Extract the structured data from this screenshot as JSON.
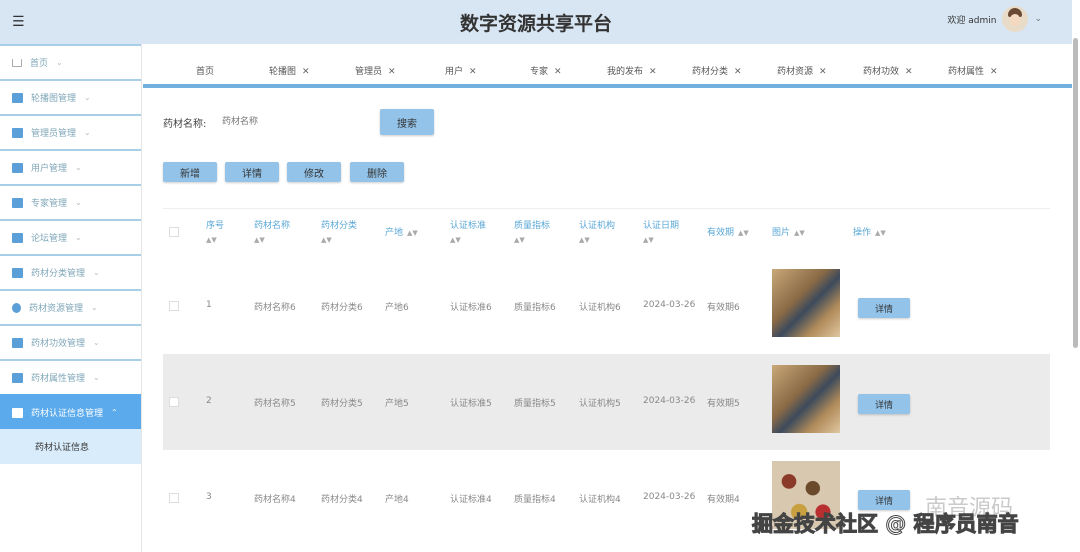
{
  "header": {
    "title": "数字资源共享平台",
    "welcome": "欢迎 admin"
  },
  "sidebar": {
    "items": [
      {
        "label": "首页",
        "icon": "home-icon"
      },
      {
        "label": "轮播图管理",
        "icon": "monitor-icon"
      },
      {
        "label": "管理员管理",
        "icon": "briefcase-icon"
      },
      {
        "label": "用户管理",
        "icon": "user-icon"
      },
      {
        "label": "专家管理",
        "icon": "user-icon"
      },
      {
        "label": "论坛管理",
        "icon": "forum-icon"
      },
      {
        "label": "药材分类管理",
        "icon": "book-icon"
      },
      {
        "label": "药材资源管理",
        "icon": "drop-icon"
      },
      {
        "label": "药材功效管理",
        "icon": "archive-icon"
      },
      {
        "label": "药材属性管理",
        "icon": "card-icon"
      },
      {
        "label": "药材认证信息管理",
        "icon": "laptop-icon"
      }
    ],
    "sub_items": [
      {
        "label": "药材认证信息"
      }
    ]
  },
  "tabs": [
    "首页",
    "轮播图",
    "管理员",
    "用户",
    "专家",
    "我的发布",
    "药材分类",
    "药材资源",
    "药材功效",
    "药材属性"
  ],
  "search": {
    "label": "药材名称:",
    "placeholder": "药材名称",
    "button": "搜索"
  },
  "actions": {
    "add": "新增",
    "detail": "详情",
    "edit": "修改",
    "delete": "删除"
  },
  "table": {
    "columns": [
      "序号",
      "药材名称",
      "药材分类",
      "产地",
      "认证标准",
      "质量指标",
      "认证机构",
      "认证日期",
      "有效期",
      "图片",
      "操作"
    ],
    "rows": [
      {
        "c": [
          "1",
          "药材名称6",
          "药材分类6",
          "产地6",
          "认证标准6",
          "质量指标6",
          "认证机构6",
          "2024-03-26",
          "有效期6"
        ],
        "btn": "详情"
      },
      {
        "c": [
          "2",
          "药材名称5",
          "药材分类5",
          "产地5",
          "认证标准5",
          "质量指标5",
          "认证机构5",
          "2024-03-26",
          "有效期5"
        ],
        "btn": "详情"
      },
      {
        "c": [
          "3",
          "药材名称4",
          "药材分类4",
          "产地4",
          "认证标准4",
          "质量指标4",
          "认证机构4",
          "2024-03-26",
          "有效期4"
        ],
        "btn": "详情"
      }
    ]
  },
  "watermark": {
    "text": "掘金技术社区 @ 程序员南音",
    "faint": "南音源码"
  },
  "colors": {
    "header_bg": "#d8e6f4",
    "accent": "#5aaaec",
    "button": "#93c3e8",
    "column_header": "#5aa7d6"
  }
}
